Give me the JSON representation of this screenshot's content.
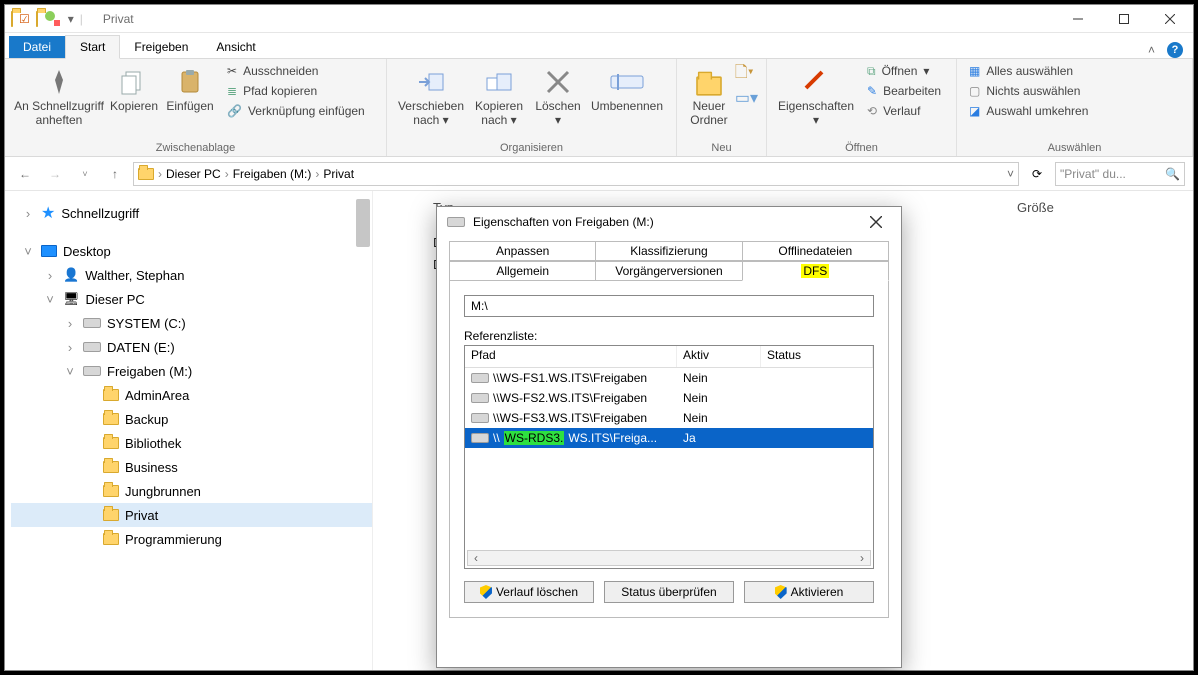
{
  "titlebar": {
    "title": "Privat"
  },
  "ribbonTabs": {
    "file": "Datei",
    "start": "Start",
    "share": "Freigeben",
    "view": "Ansicht"
  },
  "ribbon": {
    "clipboard": {
      "pin": "An Schnellzugriff anheften",
      "copy": "Kopieren",
      "paste": "Einfügen",
      "cut": "Ausschneiden",
      "copyPath": "Pfad kopieren",
      "pasteLink": "Verknüpfung einfügen",
      "group": "Zwischenablage"
    },
    "organise": {
      "moveTo": "Verschieben nach",
      "copyTo": "Kopieren nach",
      "delete": "Löschen",
      "rename": "Umbenennen",
      "group": "Organisieren"
    },
    "new": {
      "newFolder": "Neuer Ordner",
      "group": "Neu"
    },
    "open": {
      "properties": "Eigenschaften",
      "open": "Öffnen",
      "edit": "Bearbeiten",
      "history": "Verlauf",
      "group": "Öffnen"
    },
    "select": {
      "all": "Alles auswählen",
      "none": "Nichts auswählen",
      "invert": "Auswahl umkehren",
      "group": "Auswählen"
    }
  },
  "breadcrumb": {
    "parts": [
      "Dieser PC",
      "Freigaben (M:)",
      "Privat"
    ]
  },
  "search": {
    "placeholder": "\"Privat\" du..."
  },
  "tree": {
    "quick": "Schnellzugriff",
    "desktop": "Desktop",
    "user": "Walther, Stephan",
    "pc": "Dieser PC",
    "volC": "SYSTEM (C:)",
    "volE": "DATEN (E:)",
    "volM": "Freigaben (M:)",
    "folders": [
      "AdminArea",
      "Backup",
      "Bibliothek",
      "Business",
      "Jungbrunnen",
      "Privat",
      "Programmierung"
    ]
  },
  "columns": {
    "type": "Typ",
    "size": "Größe"
  },
  "listRows": {
    "r0": "Dateiordner",
    "r1": "Dateiordner"
  },
  "dialog": {
    "title": "Eigenschaften von Freigaben (M:)",
    "tabsFront": [
      "Anpassen",
      "Klassifizierung",
      "Offlinedateien"
    ],
    "tabsBack": [
      "Allgemein",
      "Vorgängerversionen",
      "DFS"
    ],
    "path": "M:\\",
    "refLabel": "Referenzliste:",
    "cols": {
      "path": "Pfad",
      "active": "Aktiv",
      "status": "Status"
    },
    "rows": [
      {
        "path": "\\\\WS-FS1.WS.ITS\\Freigaben",
        "active": "Nein",
        "sel": false
      },
      {
        "path": "\\\\WS-FS2.WS.ITS\\Freigaben",
        "active": "Nein",
        "sel": false
      },
      {
        "path": "\\\\WS-FS3.WS.ITS\\Freigaben",
        "active": "Nein",
        "sel": false
      },
      {
        "path": "\\\\WS-RDS3.WS.ITS\\Freiga...",
        "active": "Ja",
        "sel": true,
        "mark": "WS-RDS3."
      }
    ],
    "btnClear": "Verlauf löschen",
    "btnCheck": "Status überprüfen",
    "btnActivate": "Aktivieren"
  }
}
